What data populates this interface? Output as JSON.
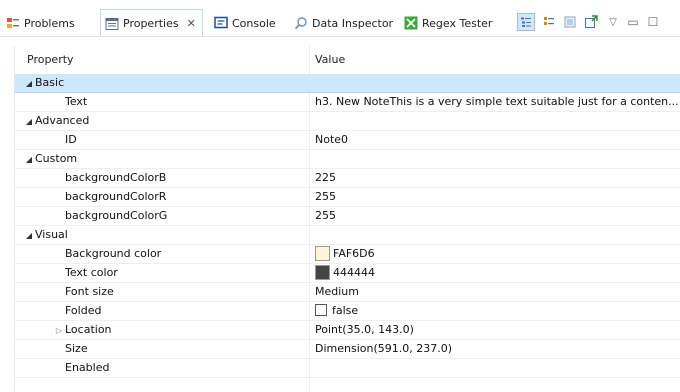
{
  "tabs": [
    {
      "label": "Problems",
      "icon": "problems-icon"
    },
    {
      "label": "Properties",
      "icon": "properties-icon",
      "active": true
    },
    {
      "label": "Console",
      "icon": "console-icon"
    },
    {
      "label": "Data Inspector",
      "icon": "search-icon"
    },
    {
      "label": "Regex Tester",
      "icon": "regex-icon"
    }
  ],
  "columns": {
    "property": "Property",
    "value": "Value"
  },
  "categories": {
    "basic": "Basic",
    "advanced": "Advanced",
    "custom": "Custom",
    "visual": "Visual"
  },
  "properties": {
    "text": {
      "name": "Text",
      "value": "h3. New NoteThis is a very simple text suitable just for a conten..."
    },
    "id": {
      "name": "ID",
      "value": "Note0"
    },
    "bgB": {
      "name": "backgroundColorB",
      "value": "225"
    },
    "bgR": {
      "name": "backgroundColorR",
      "value": "255"
    },
    "bgG": {
      "name": "backgroundColorG",
      "value": "255"
    },
    "bgColor": {
      "name": "Background color",
      "value": "FAF6D6",
      "swatch": "#FAF6D6"
    },
    "textColor": {
      "name": "Text color",
      "value": "444444",
      "swatch": "#444444"
    },
    "fontSize": {
      "name": "Font size",
      "value": "Medium"
    },
    "folded": {
      "name": "Folded",
      "value": "false"
    },
    "location": {
      "name": "Location",
      "value": "Point(35.0, 143.0)"
    },
    "size": {
      "name": "Size",
      "value": "Dimension(591.0, 237.0)"
    },
    "enabled": {
      "name": "Enabled",
      "value": ""
    }
  },
  "colors": {
    "selection": "#cde8fb",
    "accent": "#3a78c3"
  }
}
